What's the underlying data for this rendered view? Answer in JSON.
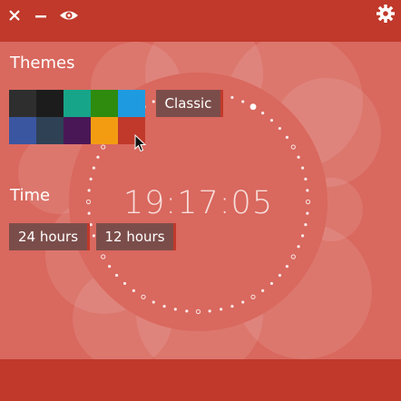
{
  "window": {
    "controls": [
      {
        "name": "close",
        "icon": "close-icon"
      },
      {
        "name": "minimize",
        "icon": "minimize-icon"
      },
      {
        "name": "visibility",
        "icon": "eye-icon"
      }
    ],
    "settings_icon": "gear-icon"
  },
  "themes": {
    "heading": "Themes",
    "swatches": [
      {
        "color": "#2e2e2e"
      },
      {
        "color": "#1c1c1c"
      },
      {
        "color": "#17a589"
      },
      {
        "color": "#2e8b0e"
      },
      {
        "color": "#1e9be0"
      },
      {
        "color": "#3a56a0"
      },
      {
        "color": "#2f4155"
      },
      {
        "color": "#4a1756"
      },
      {
        "color": "#f39c12"
      },
      {
        "color": "#c0392b"
      }
    ],
    "selected_color": "#c0392b",
    "classic_label": "Classic"
  },
  "time": {
    "heading": "Time",
    "format_24_label": "24 hours",
    "format_12_label": "12 hours"
  },
  "clock": {
    "display": "19:17:05"
  },
  "colors": {
    "accent": "#c0392b",
    "background": "#d9685e",
    "button": "#7b4d4a"
  }
}
